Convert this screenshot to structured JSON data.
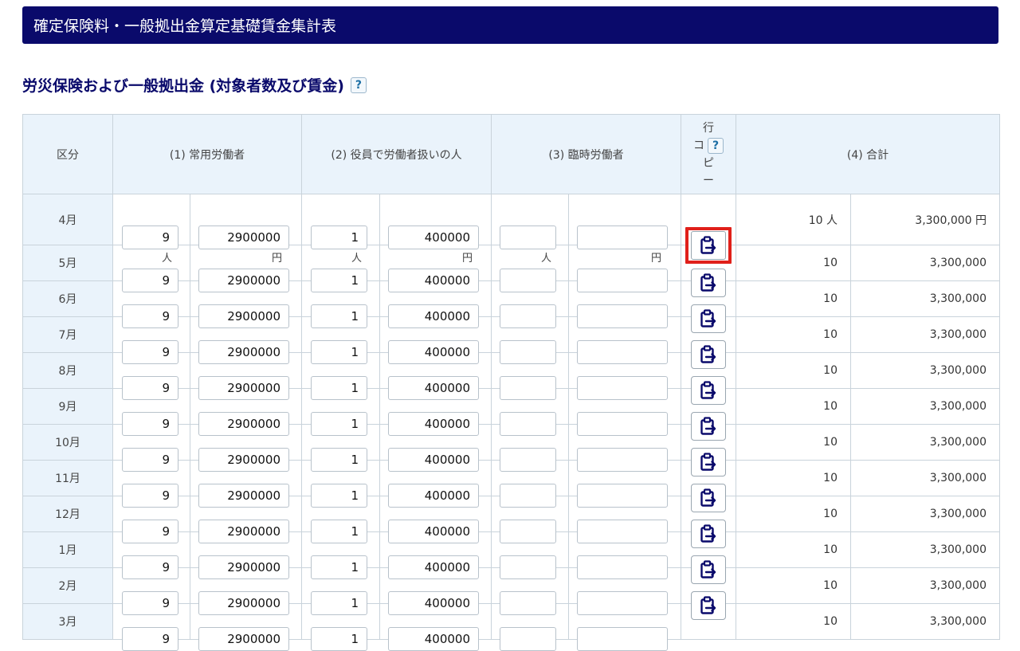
{
  "page": {
    "header_title": "確定保険料・一般拠出金算定基礎賃金集計表",
    "section_title": "労災保険および一般拠出金 (対象者数及び賃金)",
    "help_label": "?"
  },
  "table": {
    "headers": {
      "category": "区分",
      "regular": "(1) 常用労働者",
      "officers": "(2) 役員で労働者扱いの人",
      "temporary": "(3) 臨時労働者",
      "row_copy": [
        "行",
        "コ",
        "ピ",
        "ー"
      ],
      "total": "(4) 合計"
    },
    "units": {
      "person": "人",
      "yen": "円"
    },
    "rows": [
      {
        "month": "4月",
        "regular_count": "9",
        "regular_wage": "2900000",
        "officer_count": "1",
        "officer_wage": "400000",
        "temp_count": "",
        "temp_wage": "",
        "total_count": "10 人",
        "total_wage": "3,300,000 円"
      },
      {
        "month": "5月",
        "regular_count": "9",
        "regular_wage": "2900000",
        "officer_count": "1",
        "officer_wage": "400000",
        "temp_count": "",
        "temp_wage": "",
        "total_count": "10",
        "total_wage": "3,300,000"
      },
      {
        "month": "6月",
        "regular_count": "9",
        "regular_wage": "2900000",
        "officer_count": "1",
        "officer_wage": "400000",
        "temp_count": "",
        "temp_wage": "",
        "total_count": "10",
        "total_wage": "3,300,000"
      },
      {
        "month": "7月",
        "regular_count": "9",
        "regular_wage": "2900000",
        "officer_count": "1",
        "officer_wage": "400000",
        "temp_count": "",
        "temp_wage": "",
        "total_count": "10",
        "total_wage": "3,300,000"
      },
      {
        "month": "8月",
        "regular_count": "9",
        "regular_wage": "2900000",
        "officer_count": "1",
        "officer_wage": "400000",
        "temp_count": "",
        "temp_wage": "",
        "total_count": "10",
        "total_wage": "3,300,000"
      },
      {
        "month": "9月",
        "regular_count": "9",
        "regular_wage": "2900000",
        "officer_count": "1",
        "officer_wage": "400000",
        "temp_count": "",
        "temp_wage": "",
        "total_count": "10",
        "total_wage": "3,300,000"
      },
      {
        "month": "10月",
        "regular_count": "9",
        "regular_wage": "2900000",
        "officer_count": "1",
        "officer_wage": "400000",
        "temp_count": "",
        "temp_wage": "",
        "total_count": "10",
        "total_wage": "3,300,000"
      },
      {
        "month": "11月",
        "regular_count": "9",
        "regular_wage": "2900000",
        "officer_count": "1",
        "officer_wage": "400000",
        "temp_count": "",
        "temp_wage": "",
        "total_count": "10",
        "total_wage": "3,300,000"
      },
      {
        "month": "12月",
        "regular_count": "9",
        "regular_wage": "2900000",
        "officer_count": "1",
        "officer_wage": "400000",
        "temp_count": "",
        "temp_wage": "",
        "total_count": "10",
        "total_wage": "3,300,000"
      },
      {
        "month": "1月",
        "regular_count": "9",
        "regular_wage": "2900000",
        "officer_count": "1",
        "officer_wage": "400000",
        "temp_count": "",
        "temp_wage": "",
        "total_count": "10",
        "total_wage": "3,300,000"
      },
      {
        "month": "2月",
        "regular_count": "9",
        "regular_wage": "2900000",
        "officer_count": "1",
        "officer_wage": "400000",
        "temp_count": "",
        "temp_wage": "",
        "total_count": "10",
        "total_wage": "3,300,000"
      },
      {
        "month": "3月",
        "regular_count": "9",
        "regular_wage": "2900000",
        "officer_count": "1",
        "officer_wage": "400000",
        "temp_count": "",
        "temp_wage": "",
        "total_count": "10",
        "total_wage": "3,300,000"
      }
    ],
    "copy_button_icon": "clipboard-copy-icon"
  },
  "colors": {
    "header_bg": "#0a0a6b",
    "highlight": "#e0201a",
    "table_header_bg": "#eaf3fb"
  }
}
